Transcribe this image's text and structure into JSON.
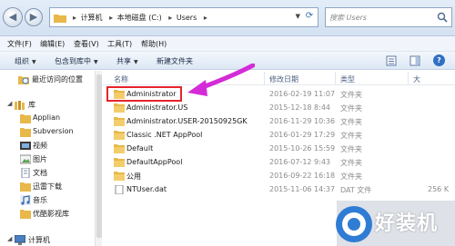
{
  "address_bar": {
    "crumbs": [
      "计算机",
      "本地磁盘 (C:)",
      "Users"
    ],
    "search_placeholder": "搜索 Users"
  },
  "menu": [
    "文件(F)",
    "编辑(E)",
    "查看(V)",
    "工具(T)",
    "帮助(H)"
  ],
  "toolbar": {
    "organize": "组织",
    "include_in_library": "包含到库中",
    "share": "共享",
    "new_folder": "新建文件夹"
  },
  "nav_pane": {
    "recent": "最近访问的位置",
    "libraries": "库",
    "items": [
      "Applian",
      "Subversion",
      "视频",
      "图片",
      "文档",
      "迅雷下载",
      "音乐",
      "优酷影视库"
    ],
    "computer": "计算机"
  },
  "columns": {
    "name": "名称",
    "date": "修改日期",
    "type": "类型",
    "size": "大"
  },
  "files": [
    {
      "name": "Administrator",
      "date": "2016-02-19 11:07",
      "type": "文件夹",
      "size": "",
      "kind": "folder"
    },
    {
      "name": "Administrator.US",
      "date": "2015-12-18 8:44",
      "type": "文件夹",
      "size": "",
      "kind": "folder"
    },
    {
      "name": "Administrator.USER-20150925GK",
      "date": "2016-11-29 10:36",
      "type": "文件夹",
      "size": "",
      "kind": "folder"
    },
    {
      "name": "Classic .NET AppPool",
      "date": "2016-01-29 17:29",
      "type": "文件夹",
      "size": "",
      "kind": "folder"
    },
    {
      "name": "Default",
      "date": "2015-10-26 15:59",
      "type": "文件夹",
      "size": "",
      "kind": "folder"
    },
    {
      "name": "DefaultAppPool",
      "date": "2016-07-12 9:43",
      "type": "文件夹",
      "size": "",
      "kind": "folder"
    },
    {
      "name": "公用",
      "date": "2016-09-22 16:18",
      "type": "文件夹",
      "size": "",
      "kind": "folder"
    },
    {
      "name": "NTUser.dat",
      "date": "2015-11-06 14:37",
      "type": "DAT 文件",
      "size": "256 K",
      "kind": "file"
    }
  ],
  "watermark": "好装机",
  "colors": {
    "highlight": "#e6232a",
    "arrow": "#d42bd8",
    "folder": "#e8b84a",
    "header_text": "#4d6185"
  }
}
